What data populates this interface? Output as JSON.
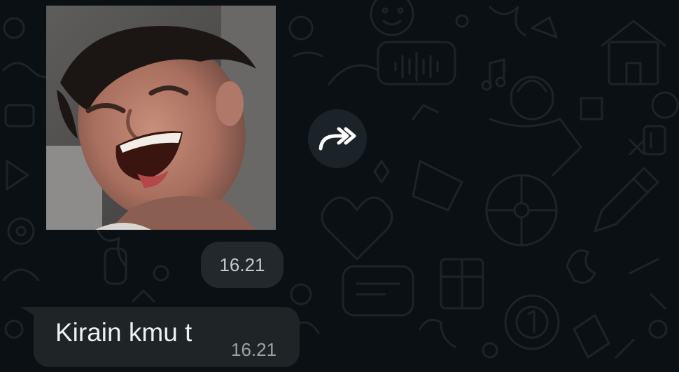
{
  "conversation": {
    "image_message": {
      "media": "photo of laughing man",
      "timestamp": "16.21"
    },
    "forward_button": {
      "icon": "forward-icon"
    },
    "text_message": {
      "text": "Kirain kmu t",
      "timestamp": "16.21"
    }
  },
  "colors": {
    "background": "#0b1014",
    "bubble": "#1f2427",
    "time_pill": "#22282c",
    "forward_button": "#1b2328",
    "text": "#eef1f2",
    "timestamp": "#9aa3a8"
  }
}
